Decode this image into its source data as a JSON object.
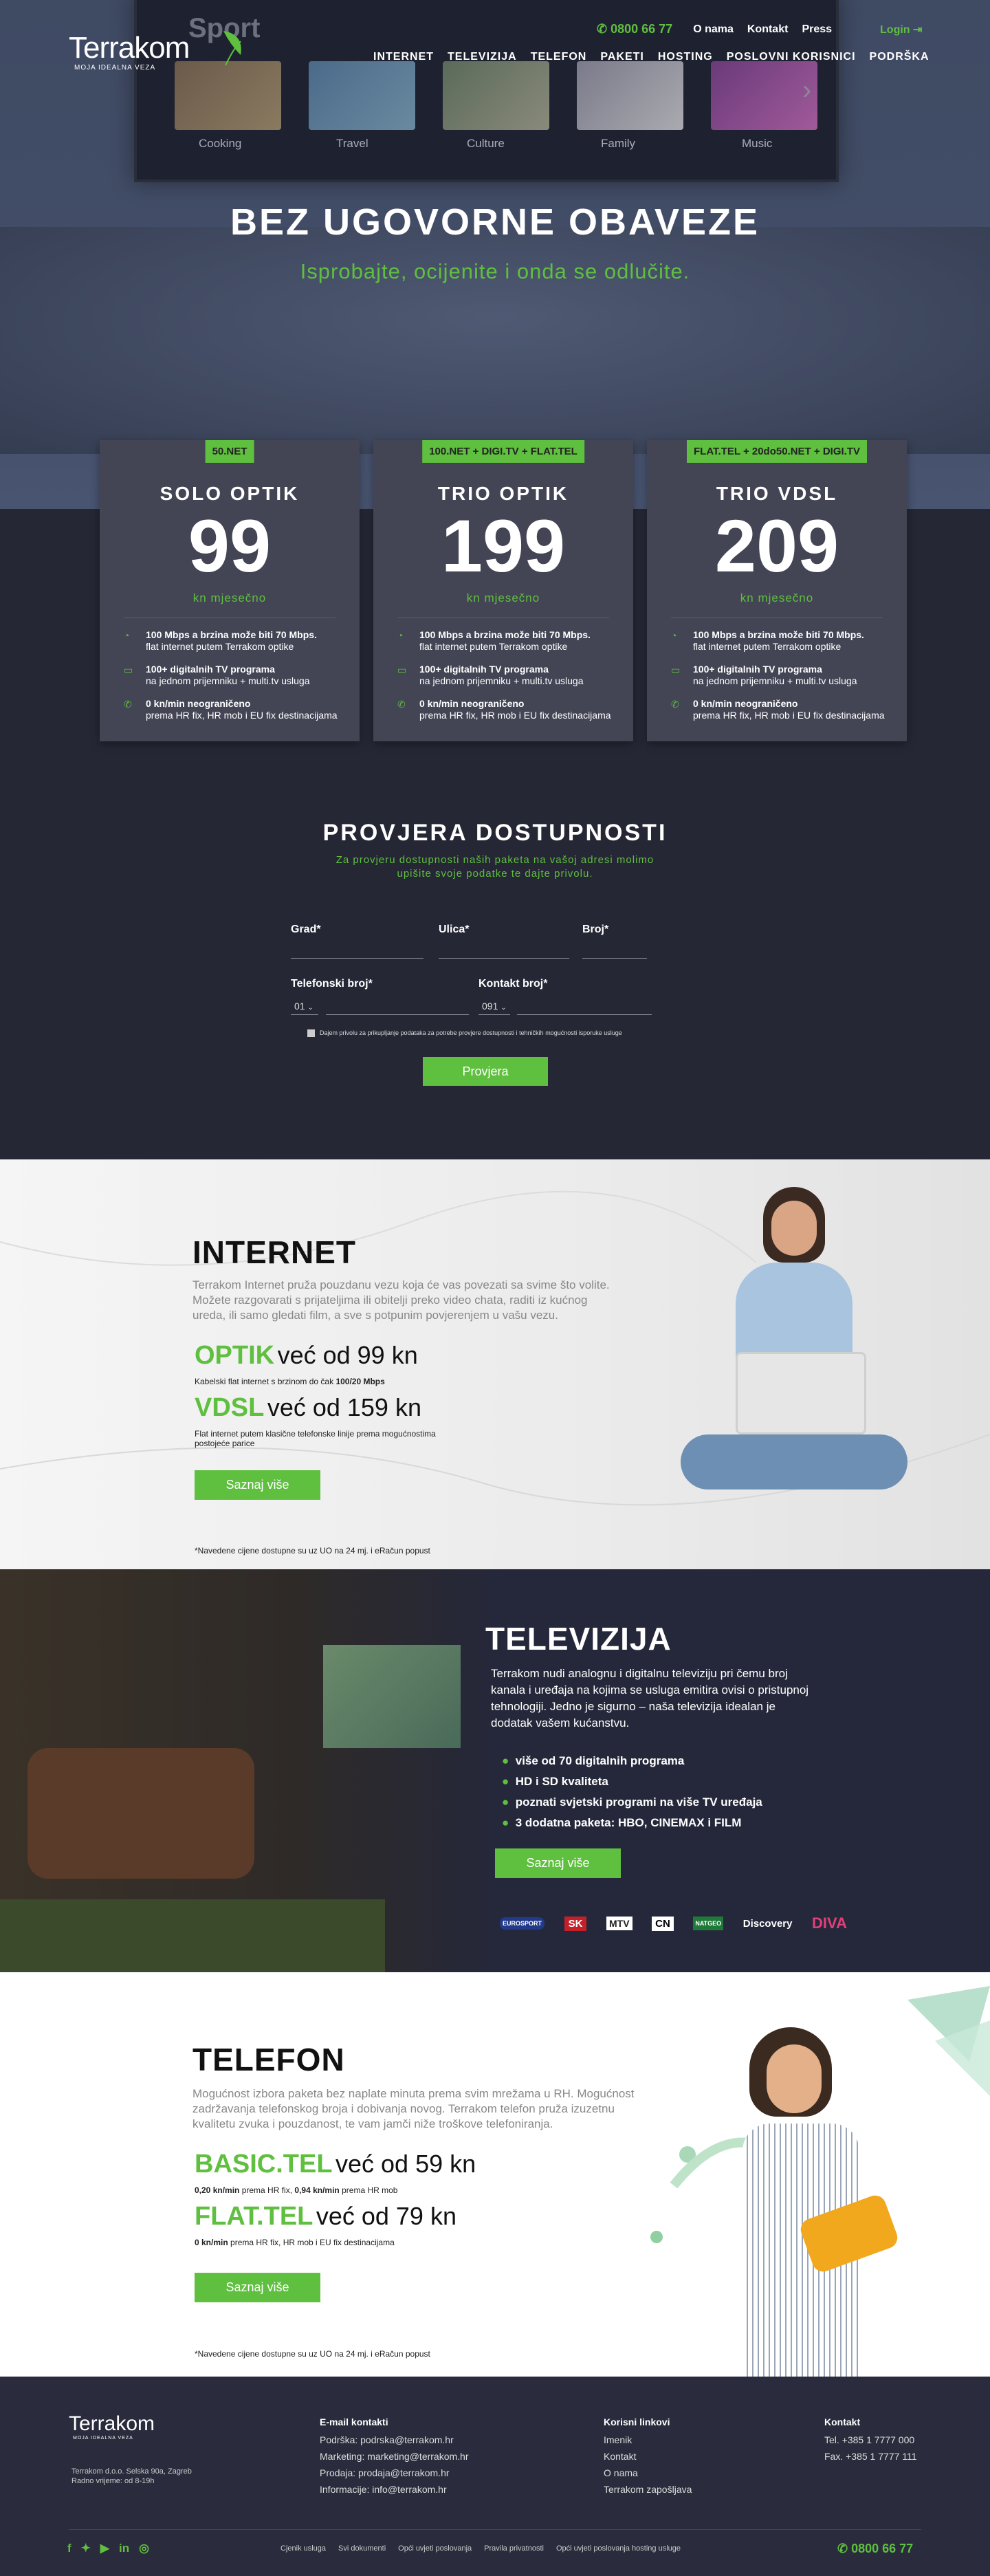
{
  "brand": {
    "name": "Terrakom",
    "tagline": "MOJA IDEALNA VEZA",
    "green": "#5fbf3f",
    "dark": "#252735"
  },
  "topbar": {
    "phone": "0800 66 77",
    "links": [
      "O nama",
      "Kontakt",
      "Press"
    ],
    "login": "Login"
  },
  "nav": [
    "INTERNET",
    "TELEVIZIJA",
    "TELEFON",
    "PAKETI",
    "HOSTING",
    "POSLOVNI KORISNICI",
    "PODRŠKA"
  ],
  "hero": {
    "tv_brand": "Sport",
    "thumbs": [
      "Cooking",
      "Travel",
      "Culture",
      "Family",
      "Music"
    ],
    "title": "BEZ UGOVORNE OBAVEZE",
    "subtitle": "Isprobajte, ocijenite i onda se odlučite."
  },
  "cards": [
    {
      "tag": "50.NET",
      "name": "SOLO OPTIK",
      "price": "99",
      "per": "kn mjesečno",
      "features": [
        {
          "icon": "speed-icon",
          "bold": "100 Mbps a brzina može biti 70 Mbps.",
          "text": "flat internet putem Terrakom optike"
        },
        {
          "icon": "tv-icon",
          "bold": "100+ digitalnih TV programa",
          "text": "na jednom prijemniku + multi.tv usluga"
        },
        {
          "icon": "phone-icon",
          "bold": "0 kn/min neograničeno",
          "text": "prema HR fix, HR mob i EU fix destinacijama"
        }
      ]
    },
    {
      "tag": "100.NET + DIGI.TV + FLAT.TEL",
      "name": "TRIO OPTIK",
      "price": "199",
      "per": "kn mjesečno",
      "features": [
        {
          "icon": "speed-icon",
          "bold": "100 Mbps a brzina može biti 70 Mbps.",
          "text": "flat internet putem Terrakom optike"
        },
        {
          "icon": "tv-icon",
          "bold": "100+ digitalnih TV programa",
          "text": "na jednom prijemniku + multi.tv usluga"
        },
        {
          "icon": "phone-icon",
          "bold": "0 kn/min neograničeno",
          "text": "prema HR fix, HR mob i EU fix destinacijama"
        }
      ]
    },
    {
      "tag": "FLAT.TEL + 20do50.NET + DIGI.TV",
      "name": "TRIO VDSL",
      "price": "209",
      "per": "kn mjesečno",
      "features": [
        {
          "icon": "speed-icon",
          "bold": "100 Mbps a brzina može biti 70 Mbps.",
          "text": "flat internet putem Terrakom optike"
        },
        {
          "icon": "tv-icon",
          "bold": "100+ digitalnih TV programa",
          "text": "na jednom prijemniku + multi.tv usluga"
        },
        {
          "icon": "phone-icon",
          "bold": "0 kn/min neograničeno",
          "text": "prema HR fix, HR mob i EU fix destinacijama"
        }
      ]
    }
  ],
  "availability": {
    "title": "PROVJERA DOSTUPNOSTI",
    "text1": "Za provjeru dostupnosti naših paketa na vašoj adresi molimo",
    "text2": "upišite svoje podatke te dajte privolu.",
    "grad": "Grad*",
    "ulica": "Ulica*",
    "broj": "Broj*",
    "tel": "Telefonski broj*",
    "kontakt": "Kontakt broj*",
    "tel_prefix": "01",
    "kontakt_prefix": "091",
    "consent": "Dajem privolu za prikupljanje podataka za potrebe provjere dostupnosti i tehničkih mogućnosti isporuke usluge",
    "button": "Provjera"
  },
  "internet": {
    "title": "INTERNET",
    "p1": "Terrakom Internet pruža pouzdanu vezu koja će vas povezati sa svime što volite.",
    "p2": "Možete razgovarati s prijateljima ili obitelji preko video chata, raditi iz kućnog",
    "p3": "ureda, ili samo gledati film, a sve s potpunim povjerenjem u vašu vezu.",
    "o1_name": "OPTIK",
    "o1_price": "već od 99 kn",
    "o1_note_a": "Kabelski flat internet s brzinom do čak ",
    "o1_note_b": "100/20 Mbps",
    "o2_name": "VDSL",
    "o2_price": "već od 159 kn",
    "o2_note1": "Flat internet putem klasične telefonske linije prema mogućnostima",
    "o2_note2": "postojeće parice",
    "button": "Saznaj više",
    "footnote": "*Navedene cijene dostupne su uz UO na 24 mj. i eRačun popust"
  },
  "televizija": {
    "title": "TELEVIZIJA",
    "p1": "Terrakom nudi analognu i digitalnu televiziju pri čemu broj",
    "p2": "kanala i uređaja na kojima se usluga emitira ovisi o pristupnoj",
    "p3": "tehnologiji. Jedno je sigurno – naša televizija idealan je",
    "p4": "dodatak vašem kućanstvu.",
    "bullets": [
      "više od 70 digitalnih programa",
      "HD i SD kvaliteta",
      "poznati svjetski programi na više TV uređaja",
      "3 dodatna paketa: HBO, CINEMAX i FILM"
    ],
    "button": "Saznaj više",
    "channels": [
      "EUROSPORT",
      "SK",
      "MTV",
      "CN",
      "NATGEO",
      "Discovery",
      "DIVA"
    ]
  },
  "telefon": {
    "title": "TELEFON",
    "p1": "Mogućnost izbora paketa bez naplate minuta prema svim mrežama u RH. Mogućnost",
    "p2": "zadržavanja telefonskog broja i dobivanja novog. Terrakom telefon pruža izuzetnu",
    "p3": "kvalitetu zvuka i pouzdanost, te vam jamči niže troškove telefoniranja.",
    "o1_name": "BASIC.TEL",
    "o1_price": "već od 59 kn",
    "o1_a": "0,20 kn/min",
    "o1_b": " prema HR fix, ",
    "o1_c": "0,94 kn/min",
    "o1_d": " prema HR mob",
    "o2_name": "FLAT.TEL",
    "o2_price": "već od 79 kn",
    "o2_a": "0 kn/min",
    "o2_b": " prema HR fix, HR mob i EU fix destinacijama",
    "button": "Saznaj više",
    "footnote": "*Navedene cijene dostupne su uz UO na 24 mj. i eRačun popust"
  },
  "footer": {
    "company": "Terrakom d.o.o. Selska 90a, Zagreb",
    "hours": "Radno vrijeme: od 8-19h",
    "email_title": "E-mail kontakti",
    "emails": [
      "Podrška: podrska@terrakom.hr",
      "Marketing: marketing@terrakom.hr",
      "Prodaja: prodaja@terrakom.hr",
      "Informacije: info@terrakom.hr"
    ],
    "links_title": "Korisni linkovi",
    "links": [
      "Imenik",
      "Kontakt",
      "O nama",
      "Terrakom zapošljava"
    ],
    "contact_title": "Kontakt",
    "tel": "Tel. +385 1 7777 000",
    "fax": "Fax. +385 1 7777 111",
    "bottom_links": [
      "Cjenik usluga",
      "Svi dokumenti",
      "Opći uvjeti poslovanja",
      "Pravila privatnosti",
      "Opći uvjeti poslovanja hosting usluge"
    ],
    "phone": "0800 66 77"
  }
}
